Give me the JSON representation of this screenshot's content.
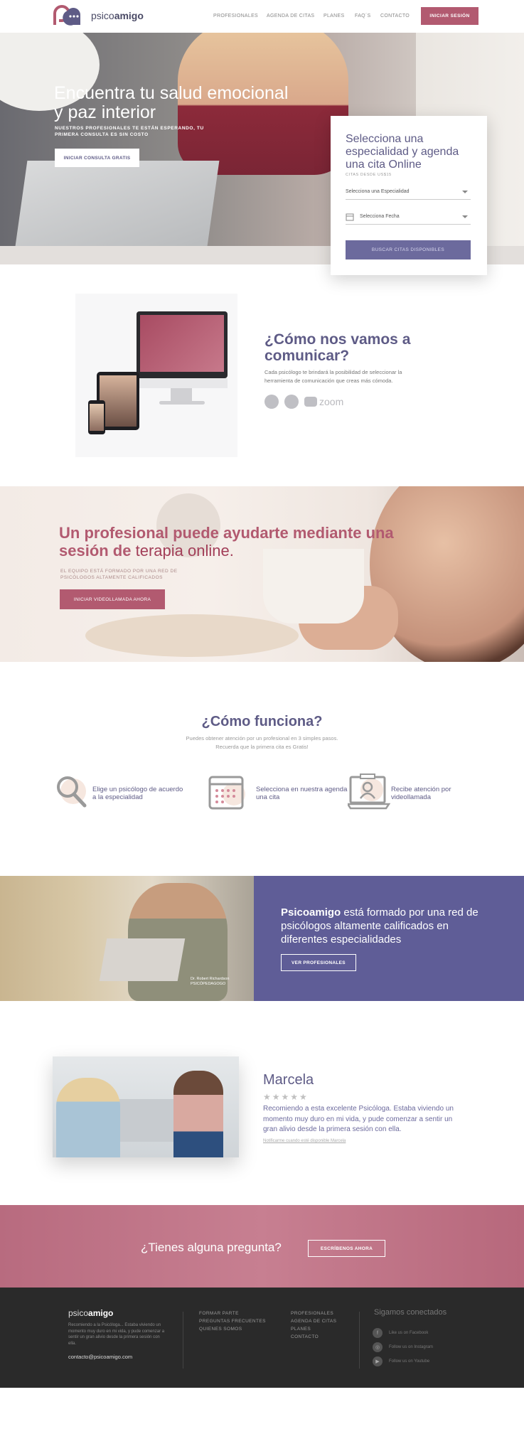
{
  "header": {
    "logo_light": "psico",
    "logo_bold": "amigo",
    "nav": [
      "PROFESIONALES",
      "AGENDA DE CITAS",
      "PLANES",
      "FAQ´S",
      "CONTACTO"
    ],
    "login": "INICIAR SESIÓN"
  },
  "hero": {
    "title": "Encuentra tu salud emocional y paz interior",
    "subtitle": "NUESTROS PROFESIONALES TE ESTÁN ESPERANDO, TU PRIMERA CONSULTA ES SIN COSTO",
    "cta": "INICIAR CONSULTA GRATIS"
  },
  "booking": {
    "title": "Selecciona una especialidad y agenda una cita Online",
    "caption": "CITAS DESDE US$15",
    "specialty_placeholder": "Selecciona una Especialidad",
    "date_placeholder": "Selecciona Fecha",
    "submit": "BUSCAR CITAS DISPONIBLES"
  },
  "communicate": {
    "title": "¿Cómo nos vamos a comunicar?",
    "text": "Cada psicólogo te brindará la posibilidad de seleccionar la herramienta de comunicación que creas más cómoda.",
    "zoom": "zoom",
    "icons": [
      "hangouts-icon",
      "whatsapp-icon",
      "zoom-camera-icon"
    ]
  },
  "banner": {
    "title_a": "Un profesional puede ayudarte mediante una sesión de ",
    "title_b": "terapia online.",
    "subtitle": "EL EQUIPO ESTÁ FORMADO POR UNA RED DE PSICÓLOGOS ALTAMENTE CALIFICADOS",
    "cta": "INICIAR VIDEOLLAMADA AHORA"
  },
  "how": {
    "title": "¿Cómo funciona?",
    "sub1": "Puedes obtener atención por un profesional en 3 simples pasos.",
    "sub2": "Recuerda que la primera cita es Gratis!",
    "steps": [
      {
        "text": "Elige un psicólogo de acuerdo a la especialidad"
      },
      {
        "text": "Selecciona en nuestra agenda una cita"
      },
      {
        "text": "Recibe atención por videollamada"
      }
    ]
  },
  "team": {
    "photo_caption_1": "Dr. Robert Richardson",
    "photo_caption_2": "PSICÓPEDAGOGO",
    "brand": "Psicoamigo",
    "text": " está formado por una red de psicólogos altamente calificados en diferentes especialidades",
    "cta": "VER PROFESIONALES"
  },
  "testimonial": {
    "name": "Marcela",
    "stars": "★★★★★",
    "quote": "Recomiendo a esta excelente Psicóloga. Estaba viviendo un momento muy duro en mi vida, y pude comenzar a sentir un gran alivio desde la primera sesión con ella.",
    "link": "Notificarme cuando esté disponible Marcela"
  },
  "question": {
    "text": "¿Tienes alguna pregunta?",
    "cta": "ESCRÍBENOS AHORA"
  },
  "footer": {
    "logo_light": "psico",
    "logo_bold": "amigo",
    "desc": "Recomiendo a la Psicóloga... Estaba viviendo un momento muy duro en mi vida, y pude comenzar a sentir un gran alivio desde la primera sesión con ella.",
    "email": "contacto@psicoamigo.com",
    "col1": [
      "FORMAR PARTE",
      "PREGUNTAS FRECUENTES",
      "QUIENES SOMOS"
    ],
    "col2": [
      "PROFESIONALES",
      "AGENDA DE CITAS",
      "PLANES",
      "CONTACTO"
    ],
    "social_title": "Sigamos conectados",
    "social": [
      {
        "icon": "f",
        "label": "Like us on Facebook"
      },
      {
        "icon": "◎",
        "label": "Follow us on Instagram"
      },
      {
        "icon": "▶",
        "label": "Follow us on Youtube"
      }
    ]
  },
  "colors": {
    "brand_purple": "#5e5b86",
    "brand_rose": "#b25a70",
    "panel_purple": "#5f5d97"
  }
}
